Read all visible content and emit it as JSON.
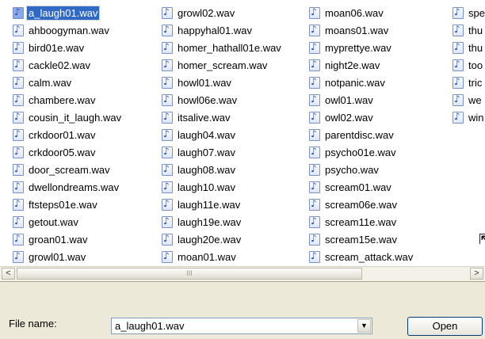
{
  "file_list": {
    "columns": [
      {
        "items": [
          {
            "name": "a_laugh01.wav",
            "selected": true
          },
          {
            "name": "ahboogyman.wav"
          },
          {
            "name": "bird01e.wav"
          },
          {
            "name": "cackle02.wav"
          },
          {
            "name": "calm.wav"
          },
          {
            "name": "chambere.wav"
          },
          {
            "name": "cousin_it_laugh.wav"
          },
          {
            "name": "crkdoor01.wav"
          },
          {
            "name": "crkdoor05.wav"
          },
          {
            "name": "door_scream.wav"
          },
          {
            "name": "dwellondreams.wav"
          },
          {
            "name": "ftsteps01e.wav"
          },
          {
            "name": "getout.wav"
          },
          {
            "name": "groan01.wav"
          },
          {
            "name": "growl01.wav"
          }
        ]
      },
      {
        "items": [
          {
            "name": "growl02.wav"
          },
          {
            "name": "happyhal01.wav"
          },
          {
            "name": "homer_hathall01e.wav"
          },
          {
            "name": "homer_scream.wav"
          },
          {
            "name": "howl01.wav"
          },
          {
            "name": "howl06e.wav"
          },
          {
            "name": "itsalive.wav"
          },
          {
            "name": "laugh04.wav"
          },
          {
            "name": "laugh07.wav"
          },
          {
            "name": "laugh08.wav"
          },
          {
            "name": "laugh10.wav"
          },
          {
            "name": "laugh11e.wav"
          },
          {
            "name": "laugh19e.wav"
          },
          {
            "name": "laugh20e.wav"
          },
          {
            "name": "moan01.wav"
          }
        ]
      },
      {
        "items": [
          {
            "name": "moan06.wav"
          },
          {
            "name": "moans01.wav"
          },
          {
            "name": "myprettye.wav"
          },
          {
            "name": "night2e.wav"
          },
          {
            "name": "notpanic.wav"
          },
          {
            "name": "owl01.wav"
          },
          {
            "name": "owl02.wav"
          },
          {
            "name": "parentdisc.wav"
          },
          {
            "name": "psycho01e.wav"
          },
          {
            "name": "psycho.wav"
          },
          {
            "name": "scream01.wav"
          },
          {
            "name": "scream06e.wav"
          },
          {
            "name": "scream11e.wav"
          },
          {
            "name": "scream15e.wav"
          },
          {
            "name": "scream_attack.wav"
          }
        ]
      },
      {
        "items": [
          {
            "name": "spe"
          },
          {
            "name": "thu"
          },
          {
            "name": "thu"
          },
          {
            "name": "too"
          },
          {
            "name": "tric"
          },
          {
            "name": "we"
          },
          {
            "name": "win"
          }
        ]
      }
    ],
    "file_icon": "audio-file-icon"
  },
  "scrollbar": {
    "left_arrow": "<",
    "right_arrow": ">",
    "thumb_grip": "III",
    "position": 0.0
  },
  "bottom": {
    "filename_label": "File name:",
    "filename_value": "a_laugh01.wav",
    "dropdown_arrow": "▼",
    "open_label": "Open"
  },
  "colors": {
    "selection": "#316ac5",
    "dialog_bg": "#ece9d8",
    "pane_bg": "#ffffff"
  }
}
